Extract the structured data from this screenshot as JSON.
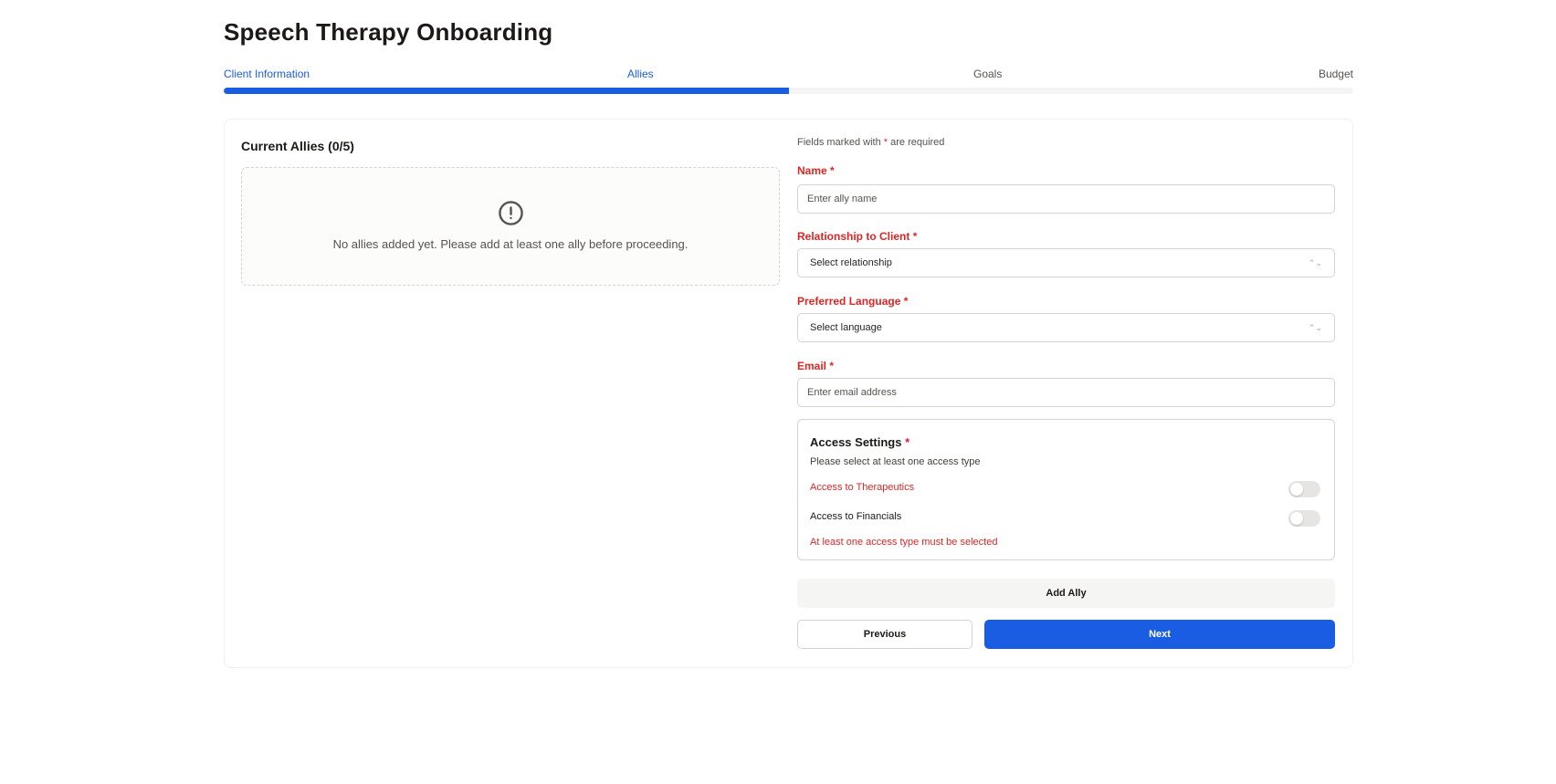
{
  "page": {
    "title": "Speech Therapy Onboarding"
  },
  "stepper": {
    "steps": [
      {
        "label": "Client Information",
        "state": "complete"
      },
      {
        "label": "Allies",
        "state": "current"
      },
      {
        "label": "Goals",
        "state": "upcoming"
      },
      {
        "label": "Budget",
        "state": "upcoming"
      }
    ],
    "progress_fraction": 0.5,
    "accent_color": "#1a5ce2"
  },
  "allies": {
    "heading": "Current Allies (0/5)",
    "empty_icon": "alert-circle-icon",
    "empty_message": "No allies added yet. Please add at least one ally before proceeding."
  },
  "form": {
    "note_prefix": "Fields marked with",
    "note_star": "*",
    "note_suffix": "are required",
    "name": {
      "label": "Name",
      "required": "*",
      "placeholder": "Enter ally name",
      "value": ""
    },
    "relationship": {
      "label": "Relationship to Client",
      "required": "*",
      "selected": "Select relationship"
    },
    "language": {
      "label": "Preferred Language",
      "required": "*",
      "selected": "Select language"
    },
    "email": {
      "label": "Email",
      "required": "*",
      "placeholder": "Enter email address",
      "value": ""
    },
    "access": {
      "title": "Access Settings",
      "required": "*",
      "subtitle": "Please select at least one access type",
      "therapeutics": {
        "label": "Access to Therapeutics",
        "on": false
      },
      "financials": {
        "label": "Access to Financials",
        "on": false
      },
      "error": "At least one access type must be selected"
    },
    "add_button": "Add Ally",
    "previous_button": "Previous",
    "next_button": "Next"
  },
  "colors": {
    "primary": "#1a5ce2",
    "error": "#dc2626"
  }
}
